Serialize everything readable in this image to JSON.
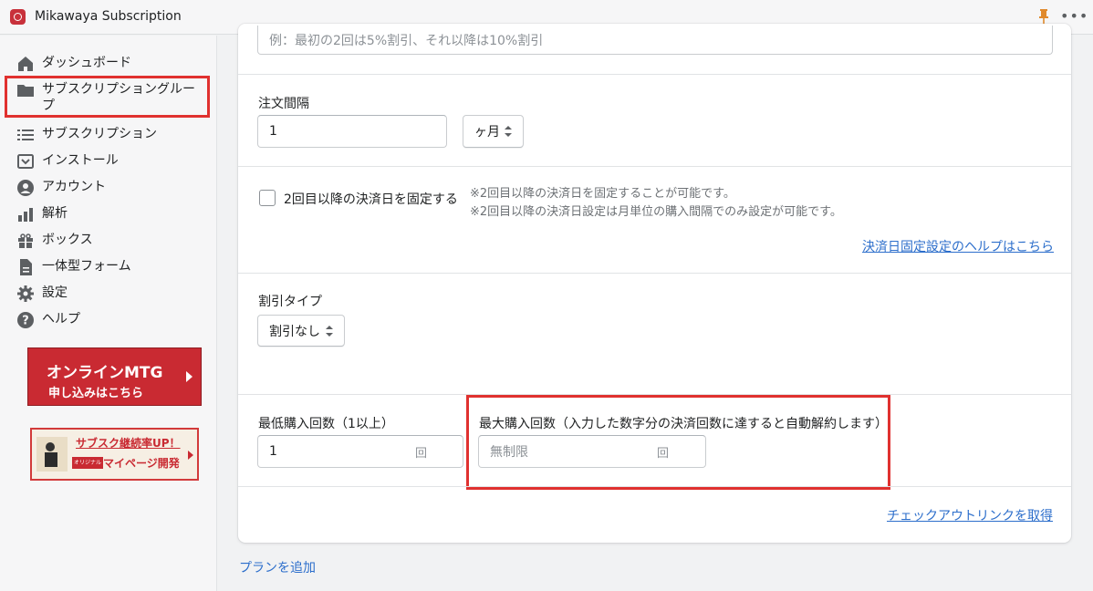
{
  "app": {
    "title": "Mikawaya Subscription"
  },
  "sidebar": {
    "items": [
      {
        "label": "ダッシュボード",
        "icon": "home-icon"
      },
      {
        "label": "サブスクリプショングループ",
        "icon": "folder-icon"
      },
      {
        "label": "サブスクリプション",
        "icon": "list-icon"
      },
      {
        "label": "インストール",
        "icon": "install-icon"
      },
      {
        "label": "アカウント",
        "icon": "account-icon"
      },
      {
        "label": "解析",
        "icon": "analytics-icon"
      },
      {
        "label": "ボックス",
        "icon": "gift-icon"
      },
      {
        "label": "一体型フォーム",
        "icon": "form-icon"
      },
      {
        "label": "設定",
        "icon": "gear-icon"
      },
      {
        "label": "ヘルプ",
        "icon": "help-icon"
      }
    ],
    "banner_mtg": {
      "line1": "オンラインMTG",
      "line2": "申し込みはこちら"
    },
    "banner_mypage": {
      "line1": "サブスク継続率UP！",
      "badge": "オリジナル",
      "line2": "マイページ開発"
    }
  },
  "form": {
    "discount_note_placeholder": "例：最初の2回は5%割引、それ以降は10%割引",
    "interval": {
      "label": "注文間隔",
      "value": "1",
      "unit": "ヶ月"
    },
    "fix_date": {
      "label": "2回目以降の決済日を固定する",
      "checked": false,
      "notes": [
        "※2回目以降の決済日を固定することが可能です。",
        "※2回目以降の決済日設定は月単位の購入間隔でのみ設定が可能です。"
      ],
      "help_link": "決済日固定設定のヘルプはこちら"
    },
    "discount_type": {
      "label": "割引タイプ",
      "value": "割引なし"
    },
    "min_purchase": {
      "label": "最低購入回数（1以上）",
      "value": "1",
      "suffix": "回"
    },
    "max_purchase": {
      "label": "最大購入回数（入力した数字分の決済回数に達すると自動解約します）",
      "placeholder": "無制限",
      "suffix": "回"
    },
    "checkout_link": "チェックアウトリンクを取得"
  },
  "add_plan": "プランを追加",
  "colors": {
    "highlight": "#e0312f",
    "link": "#2c6ecb",
    "banner_red": "#c92a32"
  }
}
